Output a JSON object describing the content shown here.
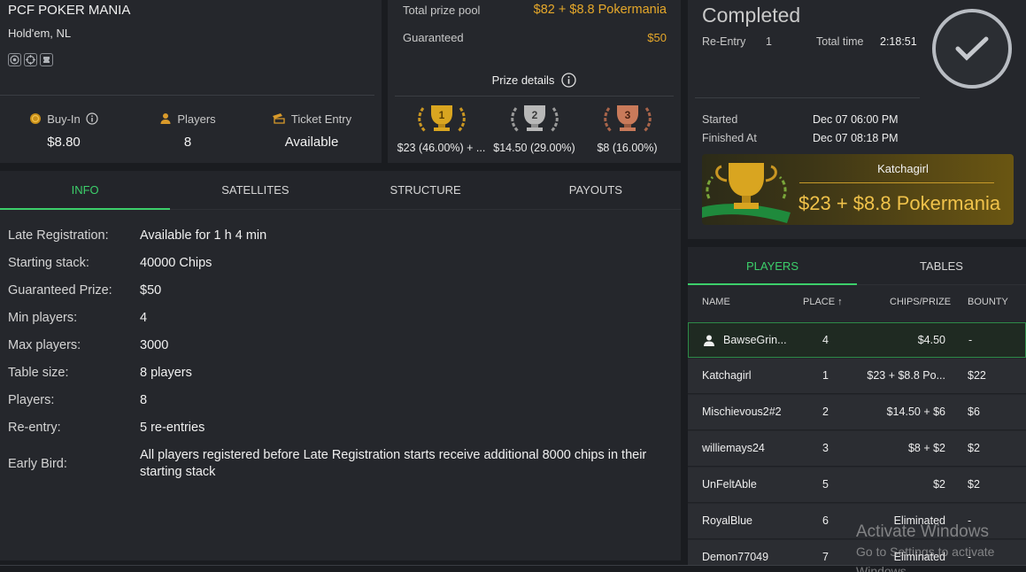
{
  "tournament": {
    "title": "PCF POKER MANIA",
    "game": "Hold'em, NL",
    "buyin_label": "Buy-In",
    "buyin_value": "$8.80",
    "players_label": "Players",
    "players_value": "8",
    "ticket_label": "Ticket Entry",
    "ticket_value": "Available"
  },
  "prize": {
    "total_label": "Total prize pool",
    "total_value": "$82 + $8.8 Pokermania",
    "guaranteed_label": "Guaranteed",
    "guaranteed_value": "$50",
    "details_label": "Prize details",
    "places": [
      {
        "rank": "1",
        "amount": "$23 (46.00%) + ...",
        "color": "#d9a520"
      },
      {
        "rank": "2",
        "amount": "$14.50 (29.00%)",
        "color": "#b8b8b8"
      },
      {
        "rank": "3",
        "amount": "$8 (16.00%)",
        "color": "#c97a5a"
      }
    ]
  },
  "status": {
    "title": "Completed",
    "reentry_label": "Re-Entry",
    "reentry_value": "1",
    "total_time_label": "Total time",
    "total_time_value": "2:18:51",
    "started_label": "Started",
    "started_value": "Dec 07 06:00 PM",
    "finished_label": "Finished At",
    "finished_value": "Dec 07 08:18 PM",
    "winner_name": "Katchagirl",
    "winner_prize": "$23 + $8.8 Pokermania"
  },
  "info_tabs": [
    "INFO",
    "SATELLITES",
    "STRUCTURE",
    "PAYOUTS"
  ],
  "info": [
    {
      "k": "Late Registration:",
      "v": "Available for 1 h 4 min"
    },
    {
      "k": "Starting stack:",
      "v": "40000 Chips"
    },
    {
      "k": "Guaranteed Prize:",
      "v": "$50"
    },
    {
      "k": "Min players:",
      "v": "4"
    },
    {
      "k": "Max players:",
      "v": "3000"
    },
    {
      "k": "Table size:",
      "v": "8 players"
    },
    {
      "k": "Players:",
      "v": "8"
    },
    {
      "k": "Re-entry:",
      "v": "5 re-entries"
    },
    {
      "k": "Early Bird:",
      "v": "All players registered before Late Registration starts receive additional 8000 chips in their starting stack"
    }
  ],
  "player_tabs": [
    "PLAYERS",
    "TABLES"
  ],
  "player_headers": {
    "name": "NAME",
    "place": "PLACE ↑",
    "chips": "CHIPS/PRIZE",
    "bounty": "BOUNTY"
  },
  "players": [
    {
      "name": "BawseGrin...",
      "place": "4",
      "prize": "$4.50",
      "bounty": "-"
    },
    {
      "name": "Katchagirl",
      "place": "1",
      "prize": "$23 + $8.8 Po...",
      "bounty": "$22"
    },
    {
      "name": "Mischievous2#2",
      "place": "2",
      "prize": "$14.50 + $6",
      "bounty": "$6"
    },
    {
      "name": "williemays24",
      "place": "3",
      "prize": "$8 + $2",
      "bounty": "$2"
    },
    {
      "name": "UnFeltAble",
      "place": "5",
      "prize": "$2",
      "bounty": "$2"
    },
    {
      "name": "RoyalBlue",
      "place": "6",
      "prize": "Eliminated",
      "bounty": "-"
    },
    {
      "name": "Demon77049",
      "place": "7",
      "prize": "Eliminated",
      "bounty": "-"
    }
  ],
  "watermark": {
    "line1": "Activate Windows",
    "line2": "Go to Settings to activate Windows."
  }
}
